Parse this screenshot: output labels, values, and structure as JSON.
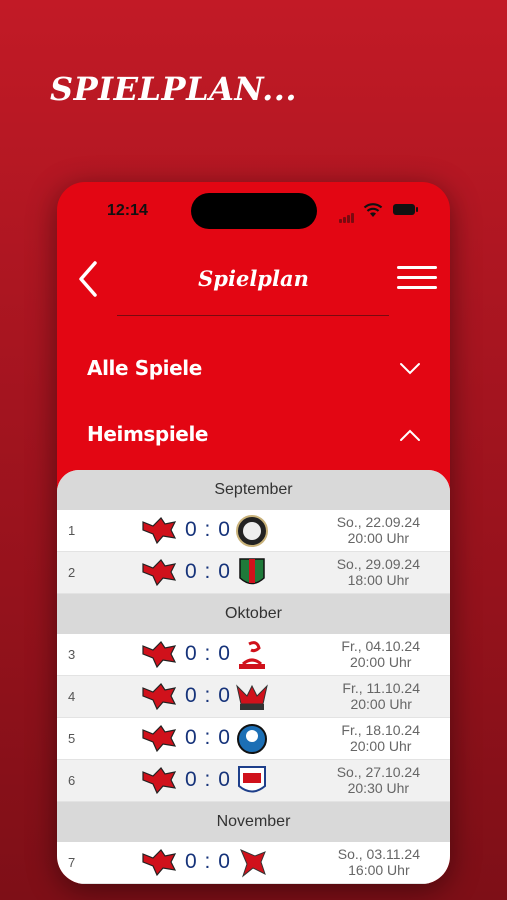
{
  "headline": "SPIELPLAN...",
  "status_bar": {
    "time": "12:14"
  },
  "nav": {
    "title": "Spielplan",
    "back_icon": "chevron-left-icon",
    "menu_icon": "hamburger-menu-icon"
  },
  "sections": [
    {
      "label": "Alle Spiele",
      "icon": "chevron-down-icon",
      "expanded": false
    },
    {
      "label": "Heimspiele",
      "icon": "chevron-up-icon",
      "expanded": true
    }
  ],
  "schedule": [
    {
      "month": "September",
      "games": [
        {
          "num": "1",
          "home_score": "0",
          "away_score": "0",
          "date": "So., 22.09.24",
          "time": "20:00 Uhr",
          "away_logo": "black-white-crest"
        },
        {
          "num": "2",
          "home_score": "0",
          "away_score": "0",
          "date": "So., 29.09.24",
          "time": "18:00 Uhr",
          "away_logo": "green-red-shield"
        }
      ]
    },
    {
      "month": "Oktober",
      "games": [
        {
          "num": "3",
          "home_score": "0",
          "away_score": "0",
          "date": "Fr., 04.10.24",
          "time": "20:00 Uhr",
          "away_logo": "red-scorpion"
        },
        {
          "num": "4",
          "home_score": "0",
          "away_score": "0",
          "date": "Fr., 11.10.24",
          "time": "20:00 Uhr",
          "away_logo": "red-wings"
        },
        {
          "num": "5",
          "home_score": "0",
          "away_score": "0",
          "date": "Fr., 18.10.24",
          "time": "20:00 Uhr",
          "away_logo": "blue-mascot"
        },
        {
          "num": "6",
          "home_score": "0",
          "away_score": "0",
          "date": "So., 27.10.24",
          "time": "20:30 Uhr",
          "away_logo": "indians-shield"
        }
      ]
    },
    {
      "month": "November",
      "games": [
        {
          "num": "7",
          "home_score": "0",
          "away_score": "0",
          "date": "So., 03.11.24",
          "time": "16:00 Uhr",
          "away_logo": "red-bird"
        }
      ]
    }
  ],
  "colors": {
    "brand_red": "#e30613",
    "score_blue": "#16337a"
  }
}
